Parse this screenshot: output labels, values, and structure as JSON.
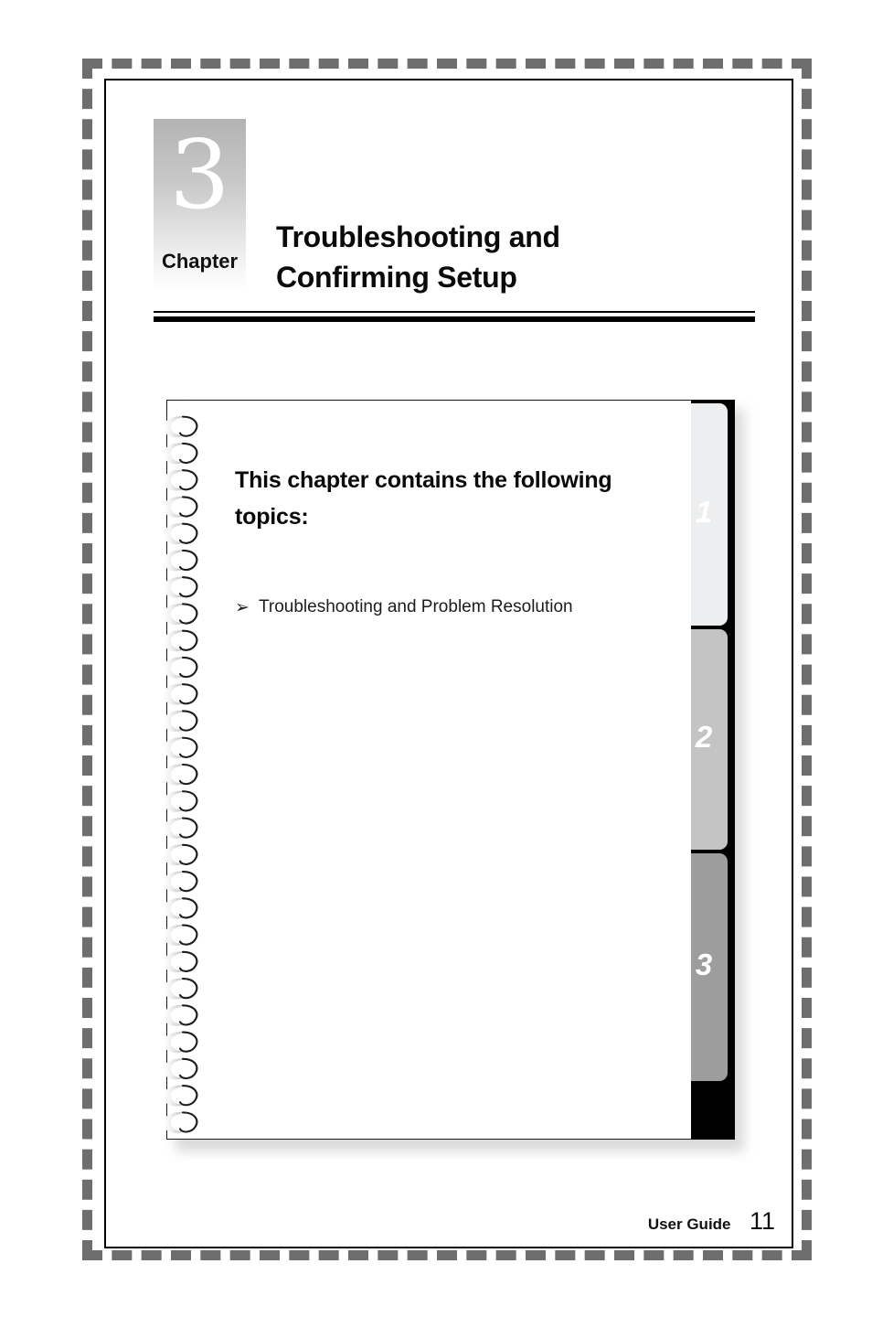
{
  "document": {
    "type": "user-guide-chapter-opener",
    "page_number": "11"
  },
  "chapter": {
    "number": "3",
    "label": "Chapter",
    "title_line_1": "Troubleshooting and",
    "title_line_2": "Confirming Setup"
  },
  "notebook": {
    "heading": "This chapter contains the following topics:",
    "bullet_glyph": "➢",
    "topics": [
      {
        "label": "Troubleshooting and Problem Resolution"
      }
    ],
    "tabs": [
      {
        "number": "1",
        "color": "#eceef0"
      },
      {
        "number": "2",
        "color": "#c4c4c4"
      },
      {
        "number": "3",
        "color": "#9d9d9d"
      }
    ],
    "spiral_ring_count": 27
  },
  "footer": {
    "label": "User Guide",
    "page": "11"
  },
  "colors": {
    "frame_dash": "#6e6e6e",
    "inner_border": "#000000",
    "tab_spine": "#000000",
    "badge_gradient_top": "#b3b3b3",
    "badge_gradient_bottom": "#ffffff",
    "text": "#0a0a0a"
  }
}
